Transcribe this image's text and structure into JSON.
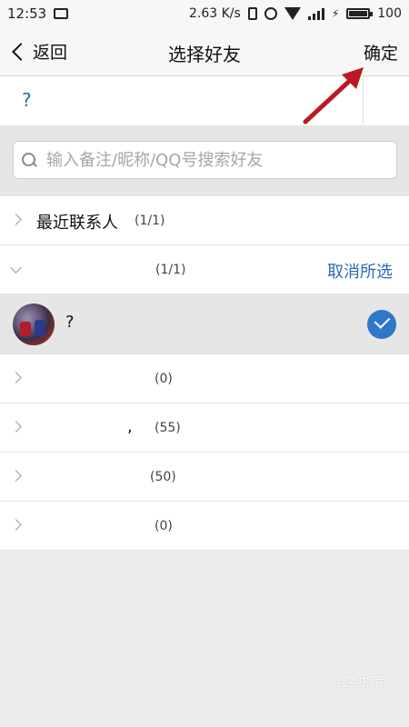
{
  "status_bar": {
    "time": "12:53",
    "speed": "2.63 K/s",
    "battery": "100"
  },
  "nav": {
    "back_label": "返回",
    "title": "选择好友",
    "confirm_label": "确定"
  },
  "selected": {
    "item": "?"
  },
  "search": {
    "placeholder": "输入备注/昵称/QQ号搜索好友"
  },
  "groups": [
    {
      "label": "最近联系人",
      "count": "(1/1)"
    },
    {
      "label": "",
      "count": "(1/1)",
      "action": "取消所选"
    },
    {
      "label": "",
      "count": "(0)"
    },
    {
      "label": ",",
      "count": "(55)"
    },
    {
      "label": "",
      "count": "(50)"
    },
    {
      "label": "",
      "count": "(0)"
    }
  ],
  "friend": {
    "name": "?"
  },
  "colors": {
    "accent": "#2f77c8",
    "link": "#2a6ab6",
    "arrow": "#b81c22"
  },
  "watermark": "搜狗指南"
}
